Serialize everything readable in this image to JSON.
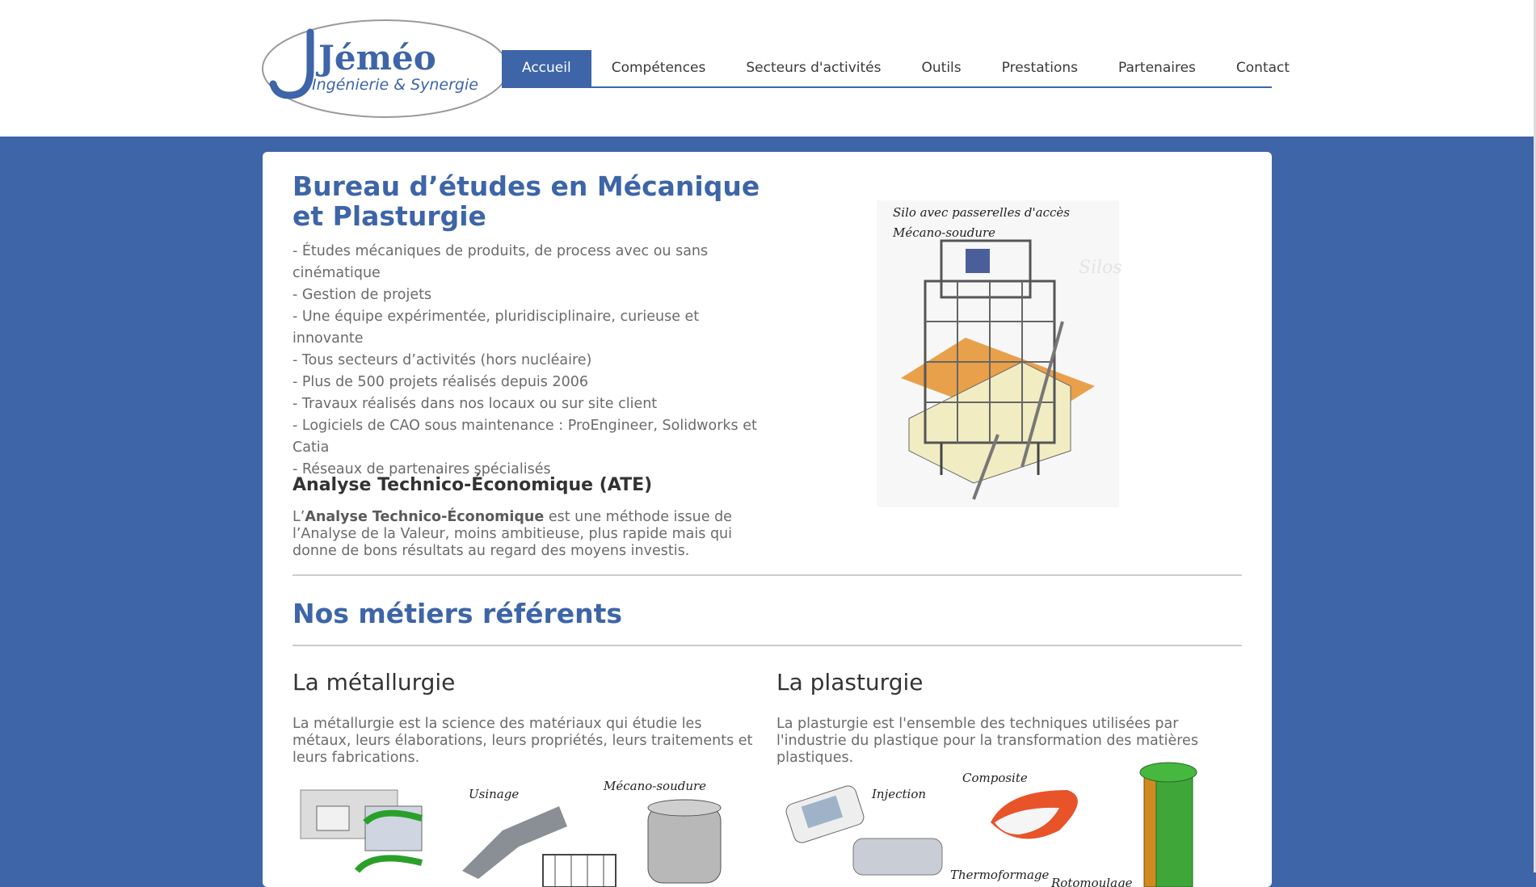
{
  "header": {
    "logo": {
      "name": "Jéméo",
      "tagline": "Ingénierie & Synergie"
    },
    "nav": [
      {
        "label": "Accueil",
        "active": true
      },
      {
        "label": "Compétences",
        "active": false
      },
      {
        "label": "Secteurs d'activités",
        "active": false
      },
      {
        "label": "Outils",
        "active": false
      },
      {
        "label": "Prestations",
        "active": false
      },
      {
        "label": "Partenaires",
        "active": false
      },
      {
        "label": "Contact",
        "active": false
      }
    ]
  },
  "main": {
    "title": "Bureau d’études en Mécanique et Plasturgie",
    "bullets": [
      "- Études mécaniques de produits, de process avec ou sans cinématique",
      "- Gestion de projets",
      "- Une équipe expérimentée, pluridisciplinaire, curieuse et innovante",
      "- Tous secteurs d’activités (hors nucléaire)",
      "- Plus de 500 projets réalisés depuis 2006",
      "- Travaux réalisés dans nos locaux ou sur site client",
      "- Logiciels de CAO sous maintenance : ProEngineer, Solidworks et Catia",
      "- Réseaux de partenaires spécialisés"
    ],
    "ate_title": "Analyse Technico-Économique (ATE)",
    "ate_prefix": "L’",
    "ate_bold": "Analyse Technico-Économique",
    "ate_rest": " est une méthode issue de l’Analyse de la Valeur, moins ambitieuse, plus rapide mais qui donne de bons résultats au regard des moyens investis.",
    "silo_image": {
      "caption": "Silo avec passerelles d'accès",
      "subcaption": "Mécano-soudure",
      "ghost": "Silos"
    }
  },
  "metiers": {
    "title": "Nos métiers référents",
    "metallurgie": {
      "title": "La métallurgie",
      "text": "La métallurgie est la science des matériaux qui étudie les métaux, leurs élaborations, leurs propriétés, leurs traitements et leurs fabrications.",
      "image_labels": [
        "Usinage",
        "Mécano-soudure"
      ]
    },
    "plasturgie": {
      "title": "La plasturgie",
      "text": "La plasturgie est l'ensemble des techniques utilisées par l'industrie du plastique pour la transformation des matières plastiques.",
      "image_labels": [
        "Injection",
        "Composite",
        "Thermoformage",
        "Rotomoulage"
      ]
    }
  },
  "colors": {
    "brand_blue": "#3d65a8",
    "text_gray": "#6b6b6b",
    "heading_dark": "#333333"
  }
}
